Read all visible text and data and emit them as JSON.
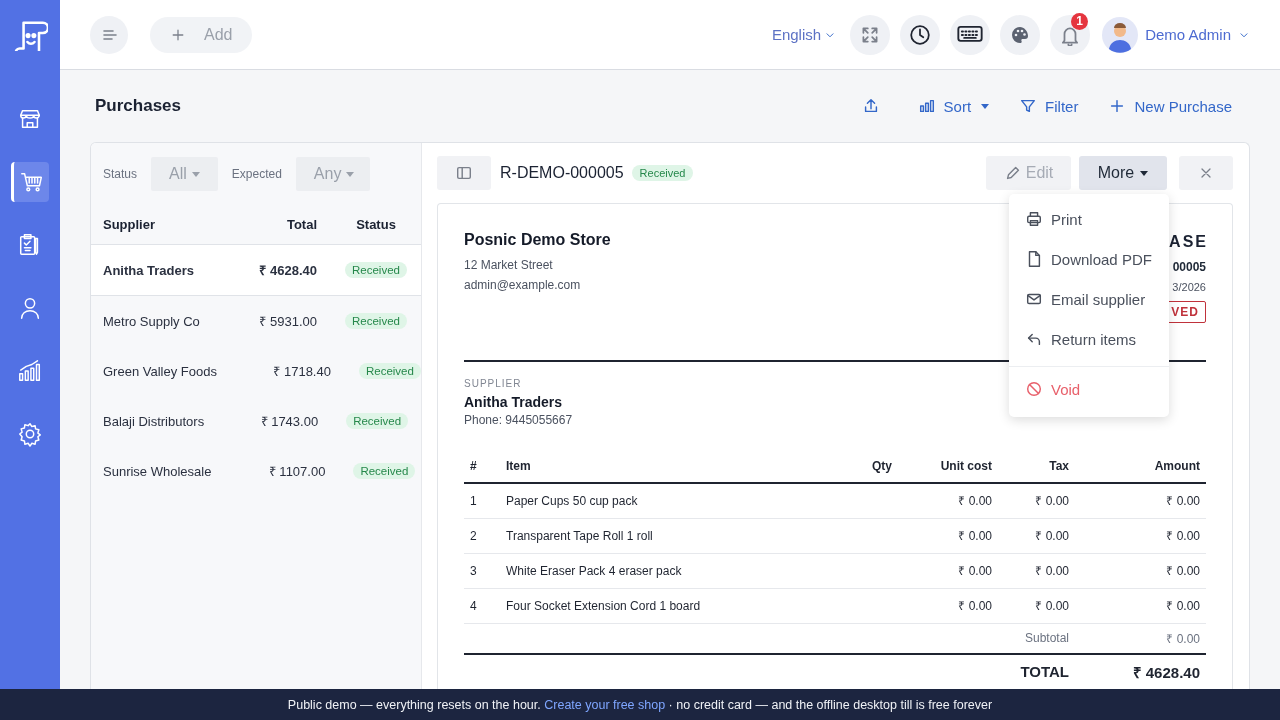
{
  "sidebar": {
    "items": [
      {
        "kind": "store",
        "selected": false
      },
      {
        "kind": "cart",
        "selected": true
      },
      {
        "kind": "clipboard",
        "selected": false
      },
      {
        "kind": "person",
        "selected": false
      },
      {
        "kind": "chart",
        "selected": false
      },
      {
        "kind": "gear",
        "selected": false
      }
    ]
  },
  "topbar": {
    "add_button": "Add",
    "language": "English",
    "notifications": "1",
    "user": "Demo Admin"
  },
  "page": {
    "title": "Purchases",
    "actions": [
      {
        "kind": "export"
      },
      {
        "kind": "sort",
        "label": "Sort"
      },
      {
        "kind": "filter",
        "label": "Filter"
      },
      {
        "kind": "new",
        "label": "New Purchase"
      }
    ]
  },
  "filters": [
    {
      "label": "Status",
      "value": "All"
    },
    {
      "label": "Expected",
      "value": "Any"
    }
  ],
  "list": {
    "columns": [
      "Supplier",
      "Total",
      "Status"
    ],
    "rows": [
      {
        "supplier": "Anitha Traders",
        "total": "₹ 4628.40",
        "status": "Received",
        "selected": true
      },
      {
        "supplier": "Metro Supply Co",
        "total": "₹ 5931.00",
        "status": "Received",
        "selected": false
      },
      {
        "supplier": "Green Valley Foods",
        "total": "₹ 1718.40",
        "status": "Received",
        "selected": false
      },
      {
        "supplier": "Balaji Distributors",
        "total": "₹ 1743.00",
        "status": "Received",
        "selected": false
      },
      {
        "supplier": "Sunrise Wholesale",
        "total": "₹ 1107.00",
        "status": "Received",
        "selected": false
      }
    ]
  },
  "detail": {
    "number": "R-DEMO-000005",
    "status": "Received",
    "edit": {
      "label": "Edit",
      "disabled": true
    },
    "more": "More",
    "store": {
      "name": "Posnic Demo Store",
      "lines": [
        "12 Market Street",
        "admin@example.com"
      ]
    },
    "doc_title": "ASE",
    "doc_number": "00005",
    "doc_date": "3/2026",
    "stamp": "VED",
    "supplier_label": "SUPPLIER",
    "supplier": {
      "name": "Anitha Traders",
      "phone": "Phone: 9445055667"
    },
    "items": {
      "columns": [
        "#",
        "Item",
        "Qty",
        "Unit cost",
        "Tax",
        "Amount"
      ],
      "rows": [
        [
          "1",
          "Paper Cups 50 cup pack",
          "",
          "₹ 0.00",
          "₹ 0.00",
          "₹ 0.00"
        ],
        [
          "2",
          "Transparent Tape Roll 1 roll",
          "",
          "₹ 0.00",
          "₹ 0.00",
          "₹ 0.00"
        ],
        [
          "3",
          "White Eraser Pack 4 eraser pack",
          "",
          "₹ 0.00",
          "₹ 0.00",
          "₹ 0.00"
        ],
        [
          "4",
          "Four Socket Extension Cord 1 board",
          "",
          "₹ 0.00",
          "₹ 0.00",
          "₹ 0.00"
        ]
      ]
    },
    "subtotal": {
      "label": "Subtotal",
      "value": "₹ 0.00"
    },
    "total": {
      "label": "TOTAL",
      "value": "₹ 4628.40"
    }
  },
  "menu": {
    "items": [
      {
        "kind": "print",
        "label": "Print",
        "danger": false
      },
      {
        "kind": "file",
        "label": "Download PDF",
        "danger": false
      },
      {
        "kind": "mail",
        "label": "Email supplier",
        "danger": false
      },
      {
        "kind": "return",
        "label": "Return items",
        "danger": false
      },
      {
        "kind": "void",
        "label": "Void",
        "danger": true
      }
    ]
  },
  "banner": {
    "text": "Public demo — everything resets on the hour.",
    "link": "Create your free shop",
    "after": "· no credit card — and the offline desktop till is free forever"
  }
}
